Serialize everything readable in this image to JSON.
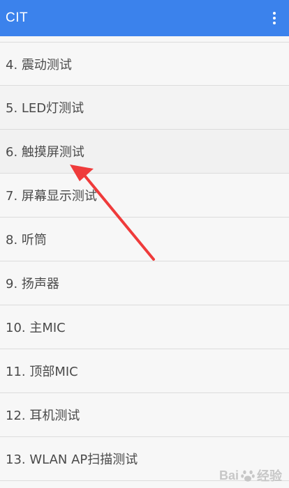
{
  "appbar": {
    "title": "CIT",
    "overflow_icon": "more-vert-icon"
  },
  "list": {
    "items": [
      "4. 震动测试",
      "5. LED灯测试",
      "6. 触摸屏测试",
      "7. 屏幕显示测试",
      "8. 听筒",
      "9. 扬声器",
      "10. 主MIC",
      "11. 顶部MIC",
      "12. 耳机测试",
      "13. WLAN AP扫描测试"
    ]
  },
  "annotation": {
    "arrow_color": "#ef3b3b"
  },
  "watermark": {
    "text_left": "Bai",
    "text_right": "经验"
  },
  "colors": {
    "appbar": "#3b82ec",
    "background": "#f7f7f7",
    "text": "#4a4a4a"
  }
}
